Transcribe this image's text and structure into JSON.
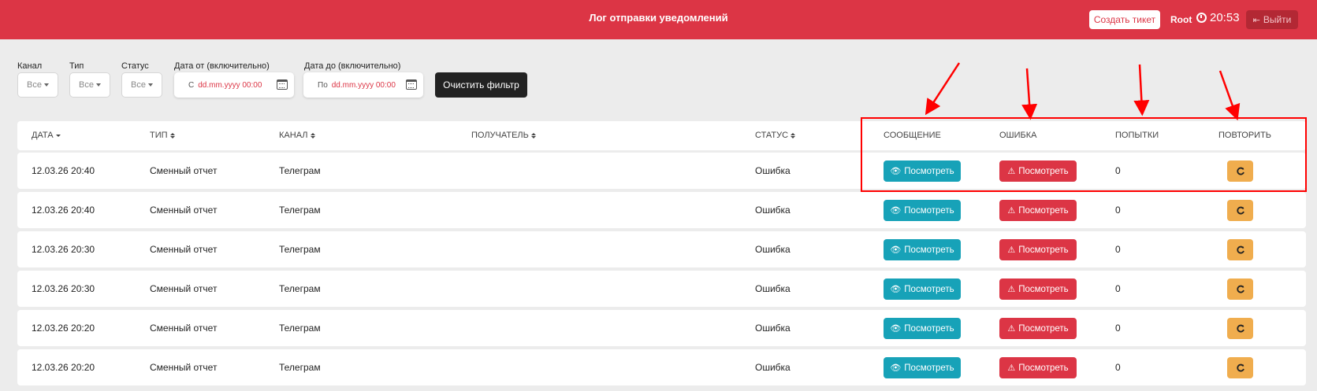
{
  "header": {
    "title": "Лог отправки уведомлений",
    "create_ticket": "Создать тикет",
    "user": "Root",
    "time": "20:53",
    "logout": "Выйти"
  },
  "filters": {
    "channel_label": "Канал",
    "type_label": "Тип",
    "status_label": "Статус",
    "date_from_label": "Дата от (включительно)",
    "date_to_label": "Дата до (включительно)",
    "channel_value": "Все",
    "type_value": "Все",
    "status_value": "Все",
    "date_from_prefix": "С",
    "date_to_prefix": "По",
    "date_placeholder": "dd.mm.yyyy 00:00",
    "clear_button": "Очистить фильтр"
  },
  "table": {
    "headers": {
      "date": "Дата",
      "type": "Тип",
      "channel": "Канал",
      "recipient": "Получатель",
      "status": "Статус",
      "message": "Сообщение",
      "error": "Ошибка",
      "attempts": "Попытки",
      "retry": "Повторить"
    },
    "view_label": "Посмотреть",
    "rows": [
      {
        "date": "12.03.26 20:40",
        "type": "Сменный отчет",
        "channel": "Телеграм",
        "recipient": "",
        "status": "Ошибка",
        "attempts": "0"
      },
      {
        "date": "12.03.26 20:40",
        "type": "Сменный отчет",
        "channel": "Телеграм",
        "recipient": "",
        "status": "Ошибка",
        "attempts": "0"
      },
      {
        "date": "12.03.26 20:30",
        "type": "Сменный отчет",
        "channel": "Телеграм",
        "recipient": "",
        "status": "Ошибка",
        "attempts": "0"
      },
      {
        "date": "12.03.26 20:30",
        "type": "Сменный отчет",
        "channel": "Телеграм",
        "recipient": "",
        "status": "Ошибка",
        "attempts": "0"
      },
      {
        "date": "12.03.26 20:20",
        "type": "Сменный отчет",
        "channel": "Телеграм",
        "recipient": "",
        "status": "Ошибка",
        "attempts": "0"
      },
      {
        "date": "12.03.26 20:20",
        "type": "Сменный отчет",
        "channel": "Телеграм",
        "recipient": "",
        "status": "Ошибка",
        "attempts": "0"
      }
    ]
  },
  "colors": {
    "brand": "#dc3545",
    "info": "#17a2b8",
    "warning": "#f0ad4e",
    "annotation": "#ff0000"
  }
}
